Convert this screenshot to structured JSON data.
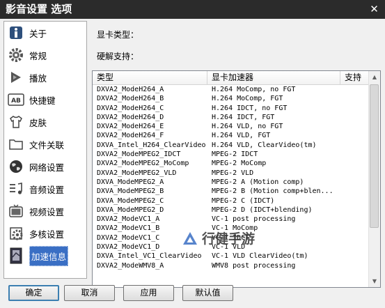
{
  "window": {
    "title": "影音设置 选项",
    "close_glyph": "✕"
  },
  "sidebar": {
    "items": [
      {
        "label": "关于",
        "icon": "info-icon"
      },
      {
        "label": "常规",
        "icon": "gear-icon"
      },
      {
        "label": "播放",
        "icon": "play-icon"
      },
      {
        "label": "快捷键",
        "icon": "keyboard-icon"
      },
      {
        "label": "皮肤",
        "icon": "shirt-icon"
      },
      {
        "label": "文件关联",
        "icon": "folder-icon"
      },
      {
        "label": "网络设置",
        "icon": "globe-icon"
      },
      {
        "label": "音频设置",
        "icon": "audio-icon"
      },
      {
        "label": "视频设置",
        "icon": "tv-icon"
      },
      {
        "label": "多核设置",
        "icon": "multicore-icon"
      },
      {
        "label": "加速信息",
        "icon": "acceleration-icon",
        "active": true
      }
    ]
  },
  "info": {
    "gpu_type_label": "显卡类型：",
    "hw_decode_label": "硬解支持："
  },
  "table": {
    "columns": [
      "类型",
      "显卡加速器",
      "支持"
    ],
    "rows": [
      [
        "DXVA2_ModeH264_A",
        "H.264 MoComp, no FGT",
        ""
      ],
      [
        "DXVA2_ModeH264_B",
        "H.264 MoComp, FGT",
        ""
      ],
      [
        "DXVA2_ModeH264_C",
        "H.264 IDCT, no FGT",
        ""
      ],
      [
        "DXVA2_ModeH264_D",
        "H.264 IDCT, FGT",
        ""
      ],
      [
        "DXVA2_ModeH264_E",
        "H.264 VLD, no FGT",
        ""
      ],
      [
        "DXVA2_ModeH264_F",
        "H.264 VLD, FGT",
        ""
      ],
      [
        "DXVA_Intel_H264_ClearVideo",
        "H.264 VLD, ClearVideo(tm)",
        ""
      ],
      [
        "DXVA2_ModeMPEG2_IDCT",
        "MPEG-2 IDCT",
        ""
      ],
      [
        "DXVA2_ModeMPEG2_MoComp",
        "MPEG-2 MoComp",
        ""
      ],
      [
        "DXVA2_ModeMPEG2_VLD",
        "MPEG-2 VLD",
        ""
      ],
      [
        "DXVA_ModeMPEG2_A",
        "MPEG-2 A (Motion comp)",
        ""
      ],
      [
        "DXVA_ModeMPEG2_B",
        "MPEG-2 B (Motion comp+blen...",
        ""
      ],
      [
        "DXVA_ModeMPEG2_C",
        "MPEG-2 C (IDCT)",
        ""
      ],
      [
        "DXVA_ModeMPEG2_D",
        "MPEG-2 D (IDCT+blending)",
        ""
      ],
      [
        "DXVA2_ModeVC1_A",
        "VC-1 post processing",
        ""
      ],
      [
        "DXVA2_ModeVC1_B",
        "VC-1 MoComp",
        ""
      ],
      [
        "DXVA2_ModeVC1_C",
        "VC-1 IDCT",
        ""
      ],
      [
        "DXVA2_ModeVC1_D",
        "VC-1 VLD",
        ""
      ],
      [
        "DXVA_Intel_VC1_ClearVideo",
        "VC-1 VLD ClearVideo(tm)",
        ""
      ],
      [
        "DXVA2_ModeWMV8_A",
        "WMV8 post processing",
        ""
      ]
    ]
  },
  "scrollbar": {
    "up_glyph": "▲",
    "down_glyph": "▼"
  },
  "buttons": {
    "ok": "确定",
    "cancel": "取消",
    "apply": "应用",
    "default": "默认值"
  },
  "watermark": {
    "text": "行健手游",
    "color": "#3a6fc4"
  }
}
